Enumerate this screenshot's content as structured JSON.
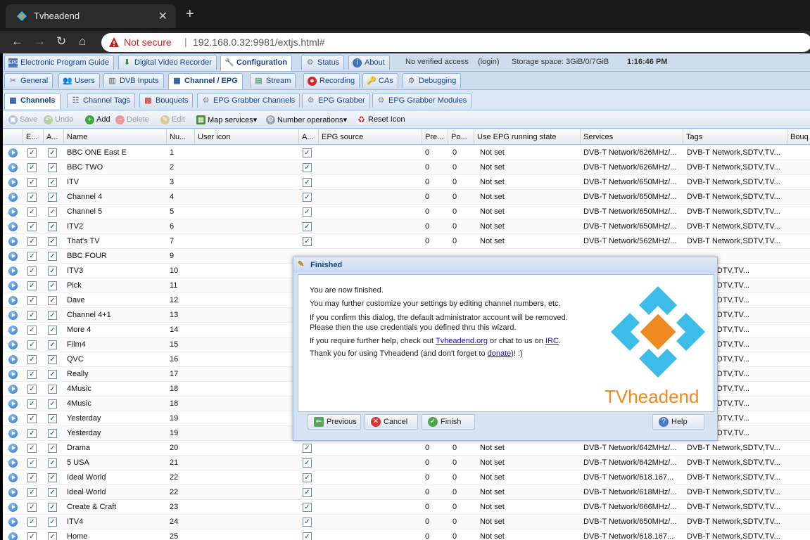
{
  "browser": {
    "tab_title": "Tvheadend",
    "new_tab": "+",
    "security": "Not secure",
    "url_sep": "|",
    "url": "192.168.0.32:9981/extjs.html#"
  },
  "main_tabs": [
    {
      "label": "Electronic Program Guide",
      "icon": "epg-icon"
    },
    {
      "label": "Digital Video Recorder",
      "icon": "dvr-icon"
    },
    {
      "label": "Configuration",
      "icon": "wrench-icon"
    },
    {
      "label": "Status",
      "icon": "status-icon"
    },
    {
      "label": "About",
      "icon": "info-icon"
    }
  ],
  "status": {
    "access": "No verified access",
    "login": "(login)",
    "storage": "Storage space: 3GiB/0/7GiB",
    "time": "1:16:46 PM"
  },
  "config_tabs": [
    {
      "label": "General"
    },
    {
      "label": "Users"
    },
    {
      "label": "DVB Inputs"
    },
    {
      "label": "Channel / EPG"
    },
    {
      "label": "Stream"
    },
    {
      "label": "Recording"
    },
    {
      "label": "CAs"
    },
    {
      "label": "Debugging"
    }
  ],
  "sub_tabs": [
    {
      "label": "Channels"
    },
    {
      "label": "Channel Tags"
    },
    {
      "label": "Bouquets"
    },
    {
      "label": "EPG Grabber Channels"
    },
    {
      "label": "EPG Grabber"
    },
    {
      "label": "EPG Grabber Modules"
    }
  ],
  "toolbar": {
    "save": "Save",
    "undo": "Undo",
    "add": "Add",
    "delete": "Delete",
    "edit": "Edit",
    "map_services": "Map services",
    "number_operations": "Number operations",
    "reset_icon": "Reset Icon"
  },
  "columns": [
    "E...",
    "A...",
    "Name",
    "Nu...",
    "User icon",
    "A...",
    "EPG source",
    "Pre...",
    "Po...",
    "Use EPG running state",
    "Services",
    "Tags",
    "Bouq"
  ],
  "rows": [
    {
      "name": "BBC ONE East E",
      "num": "1",
      "pre": "0",
      "po": "0",
      "epg": "Not set",
      "svc": "DVB-T Network/626MHz/...",
      "tags": "DVB-T Network,SDTV,TV..."
    },
    {
      "name": "BBC TWO",
      "num": "2",
      "pre": "0",
      "po": "0",
      "epg": "Not set",
      "svc": "DVB-T Network/626MHz/...",
      "tags": "DVB-T Network,SDTV,TV..."
    },
    {
      "name": "ITV",
      "num": "3",
      "pre": "0",
      "po": "0",
      "epg": "Not set",
      "svc": "DVB-T Network/650MHz/...",
      "tags": "DVB-T Network,SDTV,TV..."
    },
    {
      "name": "Channel 4",
      "num": "4",
      "pre": "0",
      "po": "0",
      "epg": "Not set",
      "svc": "DVB-T Network/650MHz/...",
      "tags": "DVB-T Network,SDTV,TV..."
    },
    {
      "name": "Channel 5",
      "num": "5",
      "pre": "0",
      "po": "0",
      "epg": "Not set",
      "svc": "DVB-T Network/650MHz/...",
      "tags": "DVB-T Network,SDTV,TV..."
    },
    {
      "name": "ITV2",
      "num": "6",
      "pre": "0",
      "po": "0",
      "epg": "Not set",
      "svc": "DVB-T Network/650MHz/...",
      "tags": "DVB-T Network,SDTV,TV..."
    },
    {
      "name": "That's TV",
      "num": "7",
      "pre": "0",
      "po": "0",
      "epg": "Not set",
      "svc": "DVB-T Network/562MHz/...",
      "tags": "DVB-T Network,SDTV,TV..."
    },
    {
      "name": "BBC FOUR",
      "num": "9",
      "pre": "",
      "po": "",
      "epg": "",
      "svc": "",
      "tags": ""
    },
    {
      "name": "ITV3",
      "num": "10",
      "pre": "",
      "po": "",
      "epg": "",
      "svc": "",
      "tags": "etwork,SDTV,TV..."
    },
    {
      "name": "Pick",
      "num": "11",
      "pre": "",
      "po": "",
      "epg": "",
      "svc": "",
      "tags": "etwork,SDTV,TV..."
    },
    {
      "name": "Dave",
      "num": "12",
      "pre": "",
      "po": "",
      "epg": "",
      "svc": "",
      "tags": "etwork,SDTV,TV..."
    },
    {
      "name": "Channel 4+1",
      "num": "13",
      "pre": "",
      "po": "",
      "epg": "",
      "svc": "",
      "tags": "etwork,SDTV,TV..."
    },
    {
      "name": "More 4",
      "num": "14",
      "pre": "",
      "po": "",
      "epg": "",
      "svc": "",
      "tags": "etwork,SDTV,TV..."
    },
    {
      "name": "Film4",
      "num": "15",
      "pre": "",
      "po": "",
      "epg": "",
      "svc": "",
      "tags": "etwork,SDTV,TV..."
    },
    {
      "name": "QVC",
      "num": "16",
      "pre": "",
      "po": "",
      "epg": "",
      "svc": "",
      "tags": "etwork,SDTV,TV..."
    },
    {
      "name": "Really",
      "num": "17",
      "pre": "",
      "po": "",
      "epg": "",
      "svc": "",
      "tags": "etwork,SDTV,TV..."
    },
    {
      "name": "4Music",
      "num": "18",
      "pre": "",
      "po": "",
      "epg": "",
      "svc": "",
      "tags": "etwork,SDTV,TV..."
    },
    {
      "name": "4Music",
      "num": "18",
      "pre": "",
      "po": "",
      "epg": "",
      "svc": "",
      "tags": "etwork,SDTV,TV..."
    },
    {
      "name": "Yesterday",
      "num": "19",
      "pre": "",
      "po": "",
      "epg": "",
      "svc": "",
      "tags": "etwork,SDTV,TV..."
    },
    {
      "name": "Yesterday",
      "num": "19",
      "pre": "",
      "po": "",
      "epg": "",
      "svc": "",
      "tags": "etwork,SDTV,TV..."
    },
    {
      "name": "Drama",
      "num": "20",
      "pre": "0",
      "po": "0",
      "epg": "Not set",
      "svc": "DVB-T Network/642MHz/...",
      "tags": "DVB-T Network,SDTV,TV..."
    },
    {
      "name": "5 USA",
      "num": "21",
      "pre": "0",
      "po": "0",
      "epg": "Not set",
      "svc": "DVB-T Network/642MHz/...",
      "tags": "DVB-T Network,SDTV,TV..."
    },
    {
      "name": "Ideal World",
      "num": "22",
      "pre": "0",
      "po": "0",
      "epg": "Not set",
      "svc": "DVB-T Network/618.167...",
      "tags": "DVB-T Network,SDTV,TV..."
    },
    {
      "name": "Ideal World",
      "num": "22",
      "pre": "0",
      "po": "0",
      "epg": "Not set",
      "svc": "DVB-T Network/618MHz/...",
      "tags": "DVB-T Network,SDTV,TV..."
    },
    {
      "name": "Create & Craft",
      "num": "23",
      "pre": "0",
      "po": "0",
      "epg": "Not set",
      "svc": "DVB-T Network/666MHz/...",
      "tags": "DVB-T Network,SDTV,TV..."
    },
    {
      "name": "ITV4",
      "num": "24",
      "pre": "0",
      "po": "0",
      "epg": "Not set",
      "svc": "DVB-T Network/650MHz/...",
      "tags": "DVB-T Network,SDTV,TV..."
    },
    {
      "name": "Home",
      "num": "25",
      "pre": "0",
      "po": "0",
      "epg": "Not set",
      "svc": "DVB-T Network/618.167...",
      "tags": "DVB-T Network,SDTV,TV..."
    }
  ],
  "dialog": {
    "title": "Finished",
    "line1": "You are now finished.",
    "line2": "You may further customize your settings by editing channel numbers, etc.",
    "line3": "If you confirm this dialog, the default administrator account will be removed.",
    "line4": "Please then the use credentials you defined thru this wizard.",
    "help_pre": "If you require further help, check out",
    "help_link": "Tvheadend.org",
    "help_mid": "or chat to us on",
    "irc_link": "IRC",
    "help_end": ".",
    "thanks_pre": "Thank you for using Tvheadend (and don't forget to",
    "donate_link": "donate",
    "thanks_end": ")! :)",
    "logo_text": "TVheadend",
    "btn_previous": "Previous",
    "btn_cancel": "Cancel",
    "btn_finish": "Finish",
    "btn_help": "Help"
  },
  "colors": {
    "logo_blue": "#3cbde8",
    "logo_orange": "#f08a21",
    "accent": "#15428b"
  }
}
